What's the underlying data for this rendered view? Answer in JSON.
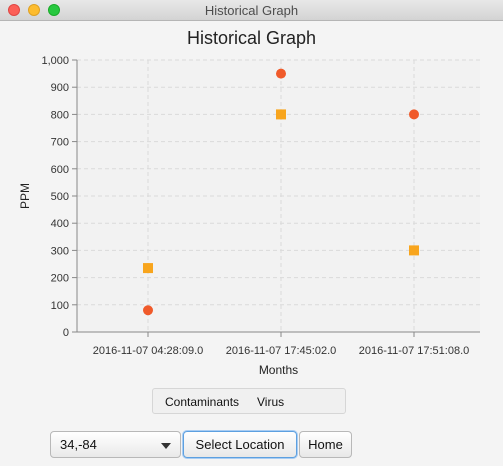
{
  "window": {
    "title": "Historical Graph"
  },
  "chart_data": {
    "type": "scatter",
    "title": "Historical Graph",
    "xlabel": "Months",
    "ylabel": "PPM",
    "categories": [
      "2016-11-07 04:28:09.0",
      "2016-11-07 17:45:02.0",
      "2016-11-07 17:51:08.0"
    ],
    "ylim": [
      0,
      1000
    ],
    "yticks": [
      "0",
      "100",
      "200",
      "300",
      "400",
      "500",
      "600",
      "700",
      "800",
      "900",
      "1,000"
    ],
    "grid": true,
    "series": [
      {
        "values": [
          80,
          950,
          800
        ],
        "color": "#f05a2a",
        "marker": "circle"
      },
      {
        "values": [
          235,
          800,
          300
        ],
        "color": "#f8a51d",
        "marker": "square"
      }
    ]
  },
  "legend": {
    "label": "Contaminants",
    "value": "Virus"
  },
  "controls": {
    "location_value": "34,-84",
    "select_location_label": "Select Location",
    "home_label": "Home"
  }
}
